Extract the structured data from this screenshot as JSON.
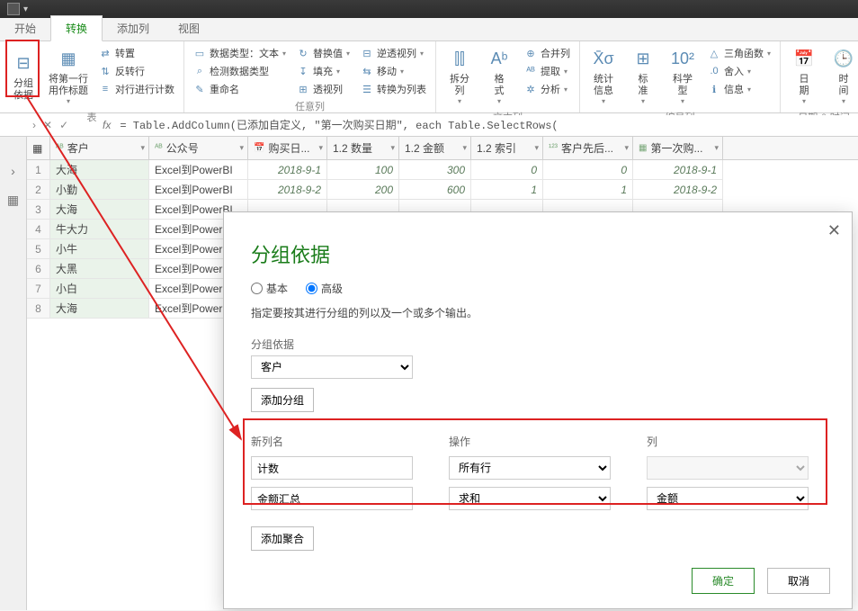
{
  "tabs": {
    "start": "开始",
    "transform": "转换",
    "addcol": "添加列",
    "view": "视图"
  },
  "ribbon": {
    "groupby": "分组\n依据",
    "useFirstRow": "将第一行\n用作标题",
    "transpose": "转置",
    "reverse": "反转行",
    "countRows": "对行进行计数",
    "glabel1": "表",
    "dataType": "数据类型：文本",
    "detectType": "检测数据类型",
    "rename": "重命名",
    "replace": "替换值",
    "fill": "填充",
    "pivot": "透视列",
    "unpivot": "逆透视列",
    "move": "移动",
    "toList": "转换为列表",
    "glabel2": "任意列",
    "split": "拆分\n列",
    "format": "格\n式",
    "merge": "合并列",
    "extract": "提取",
    "analyze": "分析",
    "glabel3": "文本列",
    "stats": "统计\n信息",
    "standard": "标\n准",
    "sci": "科学\n型",
    "trig": "三角函数",
    "round": "舍入",
    "info": "信息",
    "glabel4": "编号列",
    "date": "日\n期",
    "time": "时\n间",
    "glabel5": "日期 & 时间"
  },
  "fx": "= Table.AddColumn(已添加自定义, \"第一次购买日期\", each Table.SelectRows(",
  "columns": [
    "客户",
    "公众号",
    "购买日...",
    "1.2 数量",
    "1.2 金额",
    "1.2 索引",
    "客户先后...",
    "第一次购..."
  ],
  "rows": [
    [
      "大海",
      "Excel到PowerBI",
      "2018-9-1",
      "100",
      "300",
      "0",
      "0",
      "2018-9-1"
    ],
    [
      "小勤",
      "Excel到PowerBI",
      "2018-9-2",
      "200",
      "600",
      "1",
      "1",
      "2018-9-2"
    ],
    [
      "大海",
      "Excel到PowerBI",
      "",
      "",
      "",
      "",
      "",
      ""
    ],
    [
      "牛大力",
      "Excel到PowerBI",
      "",
      "",
      "",
      "",
      "",
      ""
    ],
    [
      "小牛",
      "Excel到PowerBI",
      "",
      "",
      "",
      "",
      "",
      ""
    ],
    [
      "大黑",
      "Excel到PowerBI",
      "",
      "",
      "",
      "",
      "",
      ""
    ],
    [
      "小白",
      "Excel到PowerBI",
      "",
      "",
      "",
      "",
      "",
      ""
    ],
    [
      "大海",
      "Excel到PowerBI",
      "",
      "",
      "",
      "",
      "",
      ""
    ]
  ],
  "dialog": {
    "title": "分组依据",
    "basic": "基本",
    "advanced": "高级",
    "desc": "指定要按其进行分组的列以及一个或多个输出。",
    "groupLabel": "分组依据",
    "groupValue": "客户",
    "addGroup": "添加分组",
    "newColLbl": "新列名",
    "opLbl": "操作",
    "colLbl": "列",
    "newCol1": "计数",
    "op1": "所有行",
    "colv1": "",
    "newCol2": "金额汇总",
    "op2": "求和",
    "colv2": "金额",
    "addAgg": "添加聚合",
    "ok": "确定",
    "cancel": "取消"
  }
}
